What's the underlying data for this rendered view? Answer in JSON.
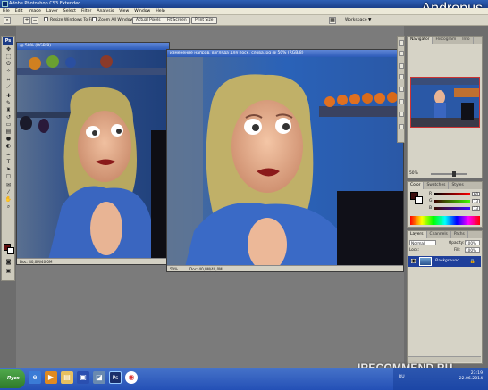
{
  "app": {
    "title": "Adobe Photoshop CS3 Extended",
    "ps_badge": "Ps"
  },
  "watermark": {
    "top": "Andropus",
    "bottom": "IRECOMMEND.RU"
  },
  "menu": [
    "File",
    "Edit",
    "Image",
    "Layer",
    "Select",
    "Filter",
    "Analysis",
    "View",
    "Window",
    "Help"
  ],
  "options": {
    "resize_windows": "Resize Windows To Fit",
    "zoom_all": "Zoom All Windows",
    "actual_pixels": "Actual Pixels",
    "fit_screen": "Fit Screen",
    "print_size": "Print Size",
    "workspace": "Workspace ▼"
  },
  "doc1": {
    "title": "@ 50% (RGB/8)",
    "status": "Doc: 40,0M/40,0M"
  },
  "doc2": {
    "title": "изменение направ. взгляда для поск. слова.jpg @ 50% (RGB/8)",
    "zoom": "50%",
    "status": "Doc: 40,0M/40,0M"
  },
  "navigator": {
    "tabs": [
      "Navigator",
      "Histogram",
      "Info"
    ],
    "zoom": "50%"
  },
  "color": {
    "tabs": [
      "Color",
      "Swatches",
      "Styles"
    ],
    "channels": [
      {
        "label": "R",
        "value": "60"
      },
      {
        "label": "G",
        "value": "13"
      },
      {
        "label": "B",
        "value": "13"
      }
    ],
    "fg": "#3c0d0d"
  },
  "layers": {
    "tabs": [
      "Layers",
      "Channels",
      "Paths"
    ],
    "mode": "Normal",
    "opacity_label": "Opacity:",
    "opacity": "100%",
    "lock_label": "Lock:",
    "fill_label": "Fill:",
    "fill": "100%",
    "layer_name": "Background"
  },
  "taskbar": {
    "start": "Пуск",
    "lang": "RU",
    "time": "23:19",
    "date": "22.06.2014",
    "apps": [
      "ie-icon",
      "media-icon",
      "folder-icon",
      "save-icon",
      "image-icon",
      "photoshop-icon",
      "chrome-icon"
    ]
  }
}
